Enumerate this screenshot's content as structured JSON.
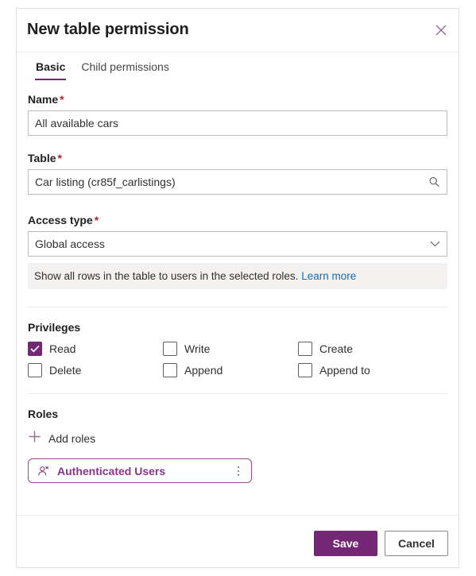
{
  "dialog": {
    "title": "New table permission",
    "close_icon": "close-icon"
  },
  "tabs": [
    {
      "label": "Basic",
      "active": true
    },
    {
      "label": "Child permissions",
      "active": false
    }
  ],
  "form": {
    "name": {
      "label": "Name",
      "required_marker": "*",
      "value": "All available cars",
      "placeholder": ""
    },
    "table": {
      "label": "Table",
      "required_marker": "*",
      "value": "Car listing (cr85f_carlistings)",
      "placeholder": "",
      "icon": "search-icon"
    },
    "access_type": {
      "label": "Access type",
      "required_marker": "*",
      "value": "Global access",
      "icon": "chevron-down-icon",
      "options": [
        "Global access"
      ]
    },
    "info": {
      "text": "Show all rows in the table to users in the selected roles.",
      "link_label": "Learn more"
    }
  },
  "privileges": {
    "label": "Privileges",
    "items": [
      {
        "label": "Read",
        "checked": true
      },
      {
        "label": "Write",
        "checked": false
      },
      {
        "label": "Create",
        "checked": false
      },
      {
        "label": "Delete",
        "checked": false
      },
      {
        "label": "Append",
        "checked": false
      },
      {
        "label": "Append to",
        "checked": false
      }
    ]
  },
  "roles": {
    "label": "Roles",
    "add_label": "Add roles",
    "add_icon": "plus-icon",
    "chips": [
      {
        "label": "Authenticated Users",
        "icon": "person-icon",
        "more_icon": "more-vertical-icon"
      }
    ]
  },
  "footer": {
    "save_label": "Save",
    "cancel_label": "Cancel"
  },
  "colors": {
    "accent": "#742774",
    "chip_border": "#a4449f",
    "chip_text": "#8b348b",
    "required": "#a4262c",
    "link": "#0f6cbd",
    "banner_bg": "#f3f2f1"
  }
}
